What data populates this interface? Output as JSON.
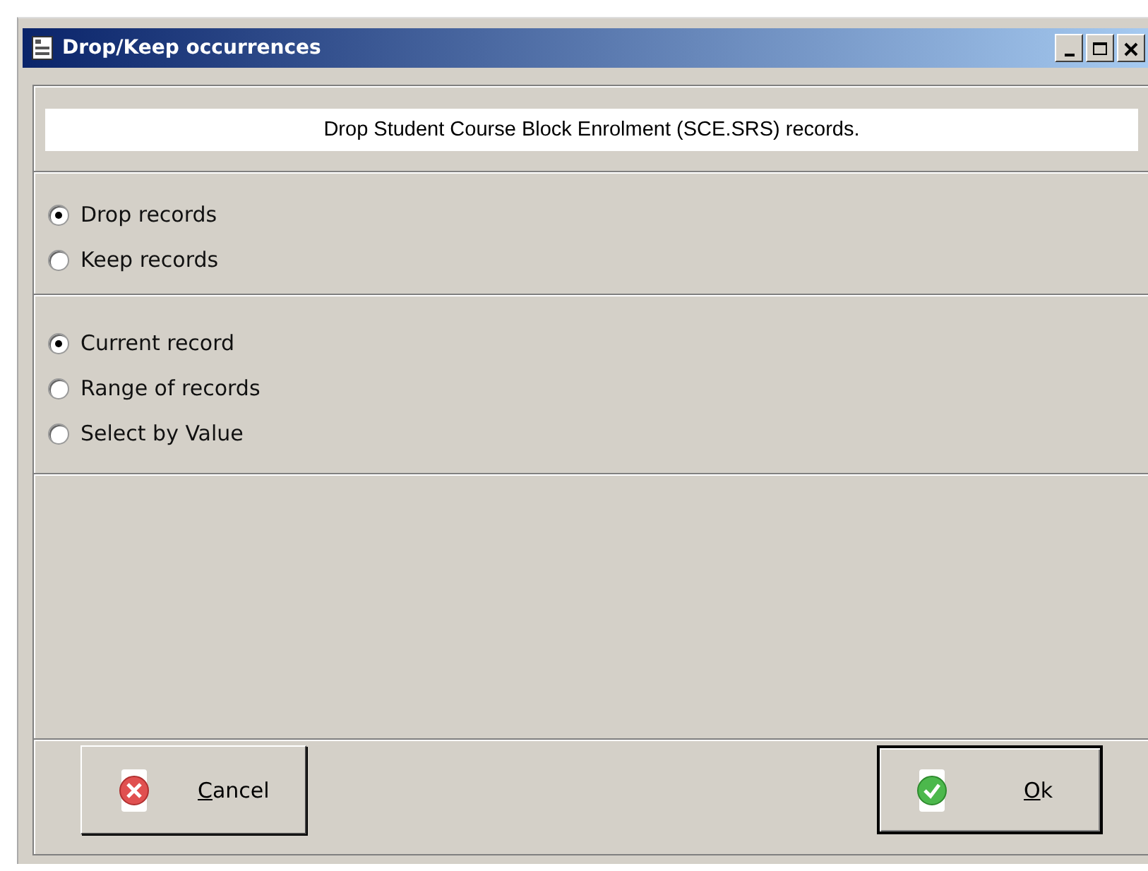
{
  "window": {
    "title": "Drop/Keep occurrences"
  },
  "message": "Drop Student Course Block Enrolment (SCE.SRS) records.",
  "option_groups": [
    {
      "options": [
        {
          "label": "Drop records",
          "selected": true
        },
        {
          "label": "Keep records",
          "selected": false
        }
      ]
    },
    {
      "options": [
        {
          "label": "Current record",
          "selected": true
        },
        {
          "label": "Range of records",
          "selected": false
        },
        {
          "label": "Select by Value",
          "selected": false
        }
      ]
    }
  ],
  "buttons": [
    {
      "label": "Cancel",
      "kind": "cancel"
    },
    {
      "label": "Ok",
      "kind": "ok"
    }
  ]
}
